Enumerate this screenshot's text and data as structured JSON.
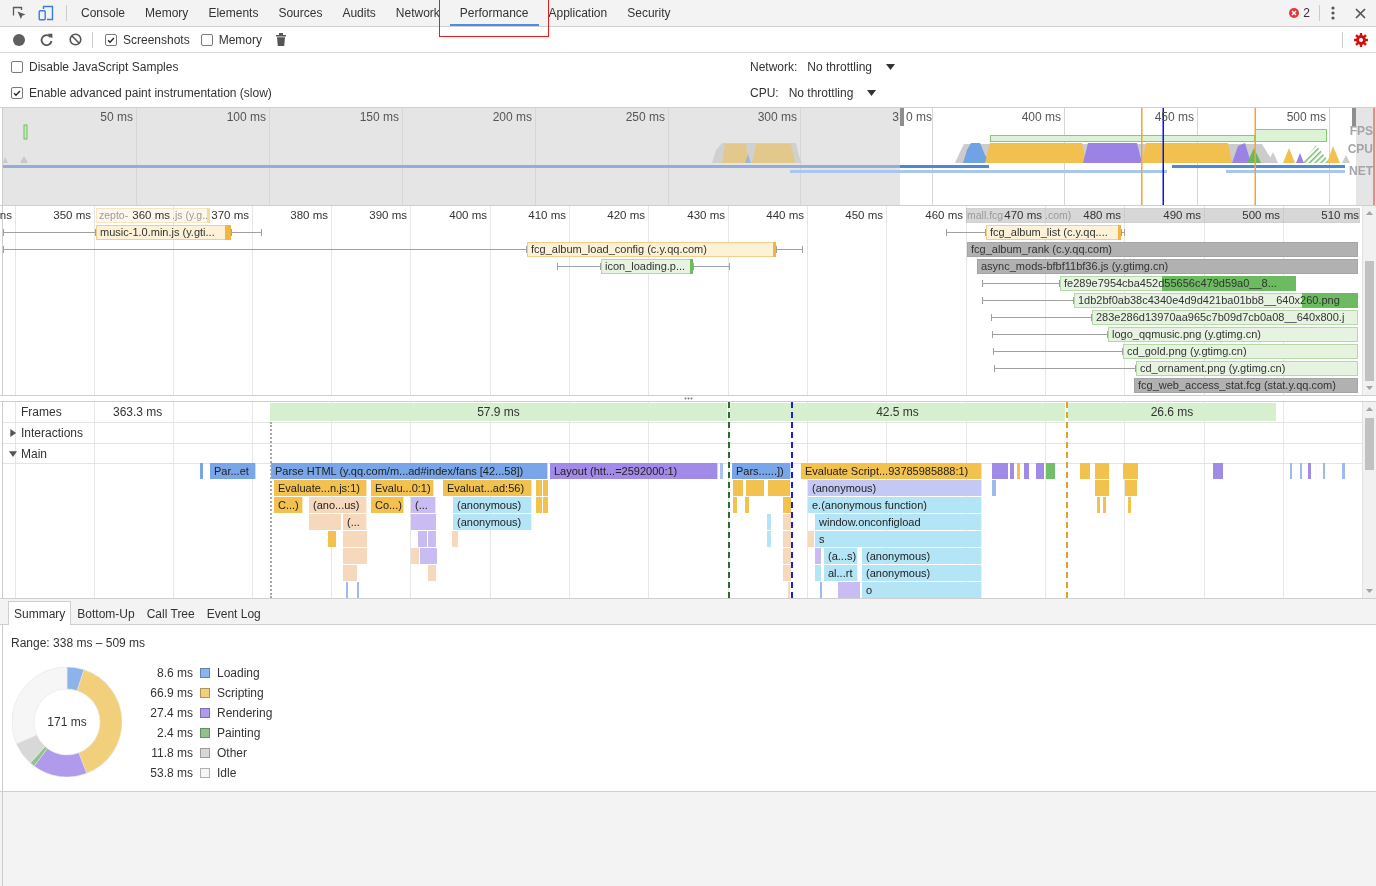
{
  "tabbar": {
    "tabs": [
      {
        "label": "Console",
        "selected": false
      },
      {
        "label": "Memory",
        "selected": false
      },
      {
        "label": "Elements",
        "selected": false
      },
      {
        "label": "Sources",
        "selected": false
      },
      {
        "label": "Audits",
        "selected": false
      },
      {
        "label": "Network",
        "selected": false
      },
      {
        "label": "Performance",
        "selected": true
      },
      {
        "label": "Application",
        "selected": false
      },
      {
        "label": "Security",
        "selected": false
      }
    ],
    "error_count": "2"
  },
  "toolbar": {
    "options": [
      {
        "label": "Screenshots",
        "checked": true
      },
      {
        "label": "Memory",
        "checked": false
      }
    ]
  },
  "capture_settings": {
    "options": [
      {
        "label": "Disable JavaScript Samples",
        "checked": false
      },
      {
        "label": "Enable advanced paint instrumentation (slow)",
        "checked": true
      }
    ],
    "throttling": [
      {
        "label": "Network:",
        "value": "No throttling"
      },
      {
        "label": "CPU:",
        "value": "No throttling"
      }
    ]
  },
  "overview": {
    "ticks": [
      {
        "label": "50 ms"
      },
      {
        "label": "100 ms"
      },
      {
        "label": "150 ms"
      },
      {
        "label": "200 ms"
      },
      {
        "label": "250 ms"
      },
      {
        "label": "300 ms"
      },
      {
        "parts": [
          "3",
          "0 ms"
        ]
      },
      {
        "label": "400 ms"
      },
      {
        "label": "450 ms"
      },
      {
        "label": "500 ms"
      }
    ],
    "lanes": [
      "FPS",
      "CPU",
      "NET"
    ]
  },
  "network": {
    "ticks": [
      "ns",
      "350 ms",
      "360 ms",
      "370 ms",
      "380 ms",
      "390 ms",
      "400 ms",
      "410 ms",
      "420 ms",
      "430 ms",
      "440 ms",
      "450 ms",
      "460 ms",
      "470 ms",
      "480 ms",
      "490 ms",
      "500 ms",
      "510 ms"
    ],
    "requests": [
      {
        "kind": "script",
        "faded": true,
        "parts": [
          "zepto-",
          ".js (y.g.."
        ]
      },
      {
        "kind": "other",
        "faded": true,
        "parts": [
          "mall.fcg",
          ".com)"
        ]
      },
      {
        "kind": "script",
        "faded": false,
        "label": "music-1.0.min.js (y.gti..."
      },
      {
        "kind": "script",
        "faded": false,
        "label": "fcg_album_list (c.y.qq...."
      },
      {
        "kind": "script",
        "faded": false,
        "label": "fcg_album_load_config (c.y.qq.com)"
      },
      {
        "kind": "other",
        "faded": false,
        "label": "fcg_album_rank (c.y.qq.com)"
      },
      {
        "kind": "image",
        "faded": false,
        "label": "icon_loading.p..."
      },
      {
        "kind": "other",
        "faded": false,
        "label": "async_mods-bfbf11bf36.js (y.gtimg.cn)"
      },
      {
        "kind": "image",
        "faded": false,
        "label": "fe289e7954cba452d55656c479d59a0__8..."
      },
      {
        "kind": "image",
        "faded": false,
        "label": "1db2bf0ab38c4340e4d9d421ba01bb8__640x260.png"
      },
      {
        "kind": "image",
        "faded": false,
        "label": "283e286d13970aa965c7b09d7cb0a08__640x800.j"
      },
      {
        "kind": "image",
        "faded": false,
        "label": "logo_qqmusic.png (y.gtimg.cn)"
      },
      {
        "kind": "image",
        "faded": false,
        "label": "cd_gold.png (y.gtimg.cn)"
      },
      {
        "kind": "image",
        "faded": false,
        "label": "cd_ornament.png (y.gtimg.cn)"
      },
      {
        "kind": "other",
        "faded": false,
        "label": "fcg_web_access_stat.fcg (stat.y.qq.com)"
      }
    ]
  },
  "main": {
    "frames_label": "Frames",
    "frames": [
      {
        "duration": "363.3 ms",
        "kind": "plain"
      },
      {
        "duration": "57.9 ms",
        "kind": "bar"
      },
      {
        "duration": "42.5 ms",
        "kind": "bar"
      },
      {
        "duration": "26.6 ms",
        "kind": "bar"
      }
    ],
    "tracks": [
      {
        "label": "Interactions",
        "expanded": false
      },
      {
        "label": "Main",
        "expanded": true
      }
    ],
    "events": [
      {
        "label": "Par...et",
        "color": "#78a6e8"
      },
      {
        "label": "Parse HTML (y.qq.com/m...ad#index/fans [42...58])",
        "color": "#78a6e8"
      },
      {
        "label": "Layout (htt...=2592000:1)",
        "color": "#a08be8"
      },
      {
        "label": "Pars......])",
        "color": "#78a6e8"
      },
      {
        "label": "Evaluate Script...93785985888:1)",
        "color": "#f2c14e"
      },
      {
        "label": "Evaluate...n.js:1)",
        "color": "#f2c14e"
      },
      {
        "label": "Evalu...0:1)",
        "color": "#f2c14e"
      },
      {
        "label": "Evaluat...ad:56)",
        "color": "#f2c14e"
      },
      {
        "label": "(anonymous)",
        "color": "#c4c8f4"
      },
      {
        "label": "C...)",
        "color": "#f2c14e"
      },
      {
        "label": "(ano...us)",
        "color": "#f6d8bd"
      },
      {
        "label": "Co...)",
        "color": "#f2c14e"
      },
      {
        "label": "(...",
        "color": "#c9bcf2"
      },
      {
        "label": "(anonymous)",
        "color": "#b3e5f6"
      },
      {
        "label": "e.(anonymous function)",
        "color": "#b3e5f6"
      },
      {
        "label": "(...",
        "color": "#f6d8bd"
      },
      {
        "label": "(anonymous)",
        "color": "#b3e5f6"
      },
      {
        "label": "window.onconfigload",
        "color": "#b3e5f6"
      },
      {
        "label": "s",
        "color": "#b3e5f6"
      },
      {
        "label": "(a...s)",
        "color": "#b3e5f6"
      },
      {
        "label": "(anonymous)",
        "color": "#b3e5f6"
      },
      {
        "label": "al...rt",
        "color": "#b3e5f6"
      },
      {
        "label": "(anonymous)",
        "color": "#b3e5f6"
      },
      {
        "label": "o",
        "color": "#b3e5f6"
      }
    ]
  },
  "details": {
    "tabs": [
      {
        "label": "Summary",
        "selected": true
      },
      {
        "label": "Bottom-Up",
        "selected": false
      },
      {
        "label": "Call Tree",
        "selected": false
      },
      {
        "label": "Event Log",
        "selected": false
      }
    ],
    "range": "Range: 338 ms – 509 ms",
    "total": "171 ms",
    "legend": [
      {
        "value": "8.6 ms",
        "color": "#8db4ea"
      },
      {
        "value": "66.9 ms",
        "color": "#f2d07b"
      },
      {
        "value": "27.4 ms",
        "color": "#b09aec"
      },
      {
        "value": "2.4 ms",
        "color": "#8fc28c"
      },
      {
        "value": "11.8 ms",
        "color": "#d8d8d8"
      },
      {
        "value": "53.8 ms",
        "color": "#f6f6f6"
      }
    ],
    "chart_data": {
      "type": "donut",
      "categories": [
        "Loading",
        "Scripting",
        "Rendering",
        "Painting",
        "Other",
        "Idle"
      ],
      "values": [
        5.03,
        39.15,
        16.03,
        1.4,
        6.9,
        31.49
      ]
    }
  }
}
